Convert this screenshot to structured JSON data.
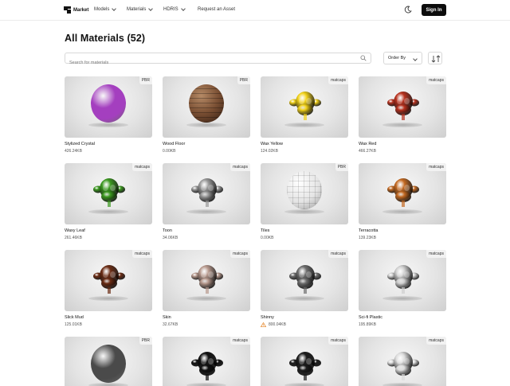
{
  "nav": {
    "brand": "Market",
    "items": [
      {
        "label": "Models",
        "dropdown": true
      },
      {
        "label": "Materials",
        "dropdown": true
      },
      {
        "label": "HDRIS",
        "dropdown": true
      },
      {
        "label": "Request an Asset",
        "dropdown": false
      }
    ],
    "theme_toggle_icon": "moon-icon",
    "signin_label": "Sign In"
  },
  "page": {
    "title": "All Materials (52)"
  },
  "search": {
    "placeholder": "Search for materials",
    "value": ""
  },
  "filters": {
    "order_by_label": "Order By",
    "sort_icon": "sort-direction-icon"
  },
  "materials": [
    {
      "name": "Stylized Crystal",
      "size": "426.24KB",
      "badge": "PBR",
      "shape": "sphere",
      "color": "#a43fbf",
      "warning": false
    },
    {
      "name": "Wood Floor",
      "size": "0.00KB",
      "badge": "PBR",
      "shape": "sphere",
      "color": "#7a4f33",
      "warning": false
    },
    {
      "name": "Wax Yellow",
      "size": "124.02KB",
      "badge": "matcaps",
      "shape": "monkey",
      "color": "#f2d21a",
      "warning": false
    },
    {
      "name": "Wax Red",
      "size": "466.27KB",
      "badge": "matcaps",
      "shape": "monkey",
      "color": "#b8321f",
      "warning": false
    },
    {
      "name": "Waxy Leaf",
      "size": "261.46KB",
      "badge": "matcaps",
      "shape": "monkey",
      "color": "#3c9a20",
      "warning": false
    },
    {
      "name": "Toon",
      "size": "34.06KB",
      "badge": "matcaps",
      "shape": "monkey",
      "color": "#9a9a9a",
      "warning": false
    },
    {
      "name": "Tiles",
      "size": "0.00KB",
      "badge": "PBR",
      "shape": "sphere",
      "color": "#e8e8e8",
      "warning": false
    },
    {
      "name": "Terracotta",
      "size": "139.23KB",
      "badge": "matcaps",
      "shape": "monkey",
      "color": "#c46a22",
      "warning": false
    },
    {
      "name": "Slick Mud",
      "size": "125.01KB",
      "badge": "matcaps",
      "shape": "monkey",
      "color": "#6b2c14",
      "warning": false
    },
    {
      "name": "Skin",
      "size": "32.67KB",
      "badge": "matcaps",
      "shape": "monkey",
      "color": "#b89a8e",
      "warning": false
    },
    {
      "name": "Shinny",
      "size": "800.04KB",
      "badge": "matcaps",
      "shape": "monkey",
      "color": "#6e6e6e",
      "warning": true
    },
    {
      "name": "Sci-fi Plastic",
      "size": "195.89KB",
      "badge": "matcaps",
      "shape": "monkey",
      "color": "#cfcfcf",
      "warning": false
    },
    {
      "name": "",
      "size": "",
      "badge": "PBR",
      "shape": "sphere",
      "color": "#4a4a4a",
      "warning": false
    },
    {
      "name": "",
      "size": "",
      "badge": "matcaps",
      "shape": "monkey",
      "color": "#111111",
      "warning": false
    },
    {
      "name": "",
      "size": "",
      "badge": "matcaps",
      "shape": "monkey",
      "color": "#1c1c1c",
      "warning": false
    },
    {
      "name": "",
      "size": "",
      "badge": "matcaps",
      "shape": "monkey",
      "color": "#dcdcdc",
      "warning": false
    }
  ],
  "colors": {
    "accent": "#0c0c0c",
    "warning": "#e5872a"
  }
}
